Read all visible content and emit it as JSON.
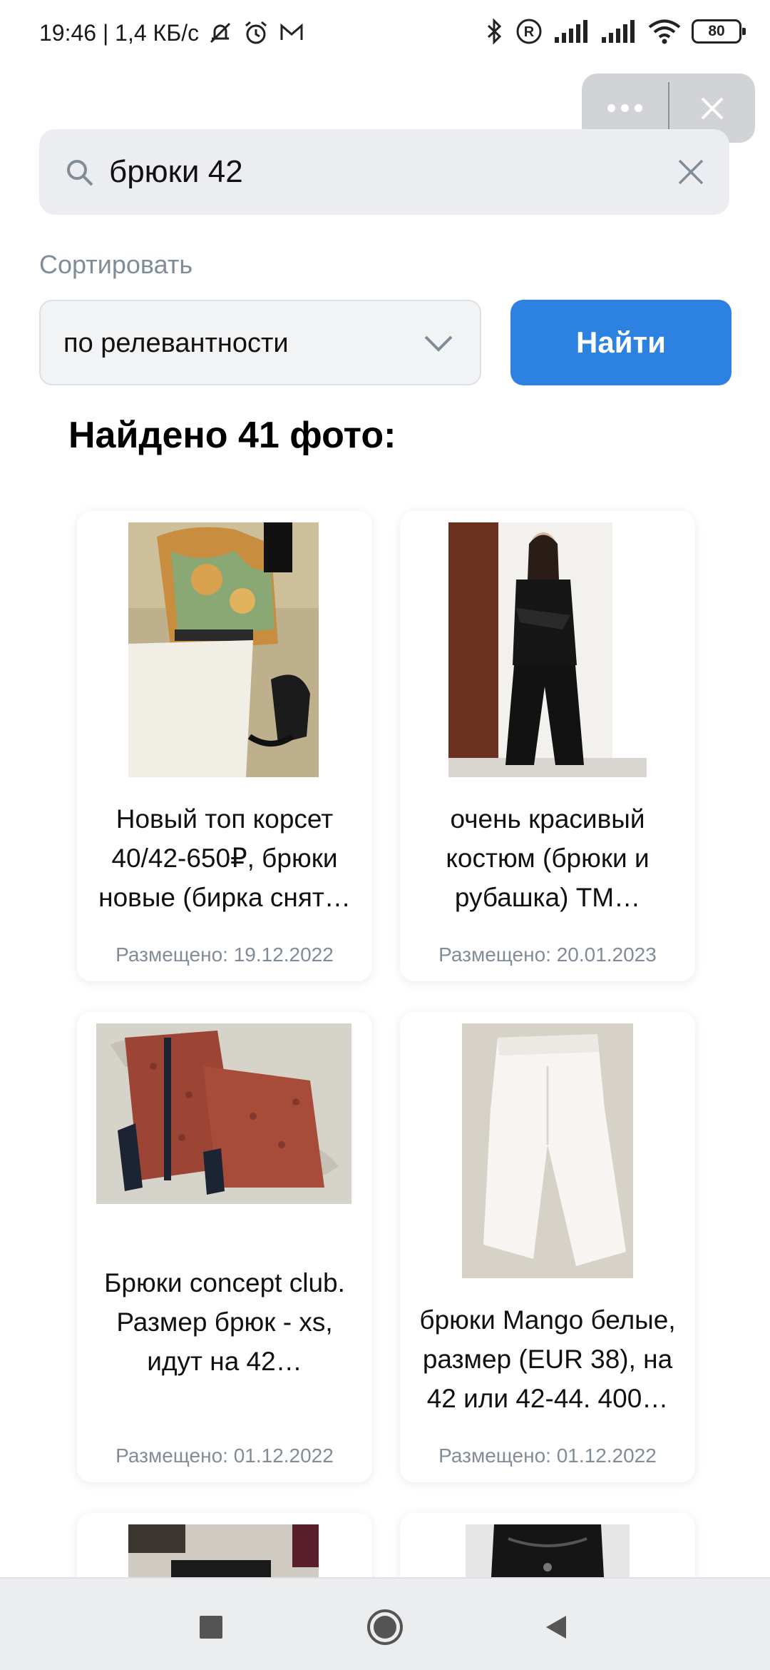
{
  "status_bar": {
    "time_speed": "19:46 | 1,4 КБ/с",
    "battery": "80"
  },
  "capsule": {
    "more_icon": "more-dots-icon",
    "close_icon": "close-icon"
  },
  "search": {
    "value": "брюки 42",
    "icon": "search-icon",
    "clear_icon": "clear-icon"
  },
  "sort": {
    "label": "Сортировать",
    "selected": "по релевантности"
  },
  "find_button": {
    "label": "Найти",
    "color": "#2d81e0"
  },
  "results": {
    "title": "Найдено 41 фото:",
    "cards": [
      {
        "title": "Новый топ корсет 40/42-650₽, брюки новые (бирка снят…",
        "date": "Размещено: 19.12.2022"
      },
      {
        "title": "очень красивый костюм (брюки и рубашка) ТМ…",
        "date": "Размещено: 20.01.2023"
      },
      {
        "title": "Брюки concept club. Размер брюк - xs, идут на 42…",
        "date": "Размещено: 01.12.2022"
      },
      {
        "title": "брюки Mango белые, размер (EUR 38), на 42 или 42-44. 400…",
        "date": "Размещено: 01.12.2022"
      }
    ]
  },
  "nav": {
    "recents_icon": "square-icon",
    "home_icon": "circle-icon",
    "back_icon": "triangle-back-icon"
  }
}
